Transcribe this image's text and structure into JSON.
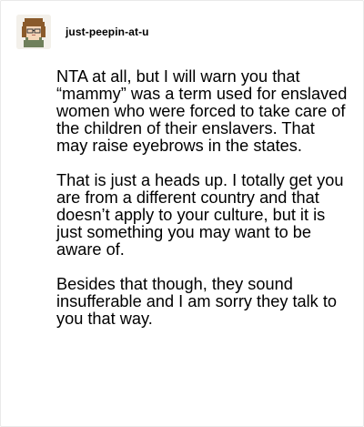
{
  "post": {
    "username": "just-peepin-at-u",
    "avatar_icon": "pixel-character-avatar-icon",
    "paragraphs": [
      "NTA at all, but I will warn you that “mammy” was a term used for enslaved women who were forced to take care of the children of their enslavers. That may raise eyebrows in the states.",
      "That is just a heads up. I totally get you are from a different country and that doesn’t apply to your culture, but it is just something you may want to be aware of.",
      "Besides that though, they sound insufferable and I am sorry they talk to you that way."
    ]
  },
  "colors": {
    "text": "#000000",
    "background": "#ffffff",
    "border": "#e9e9e9"
  }
}
